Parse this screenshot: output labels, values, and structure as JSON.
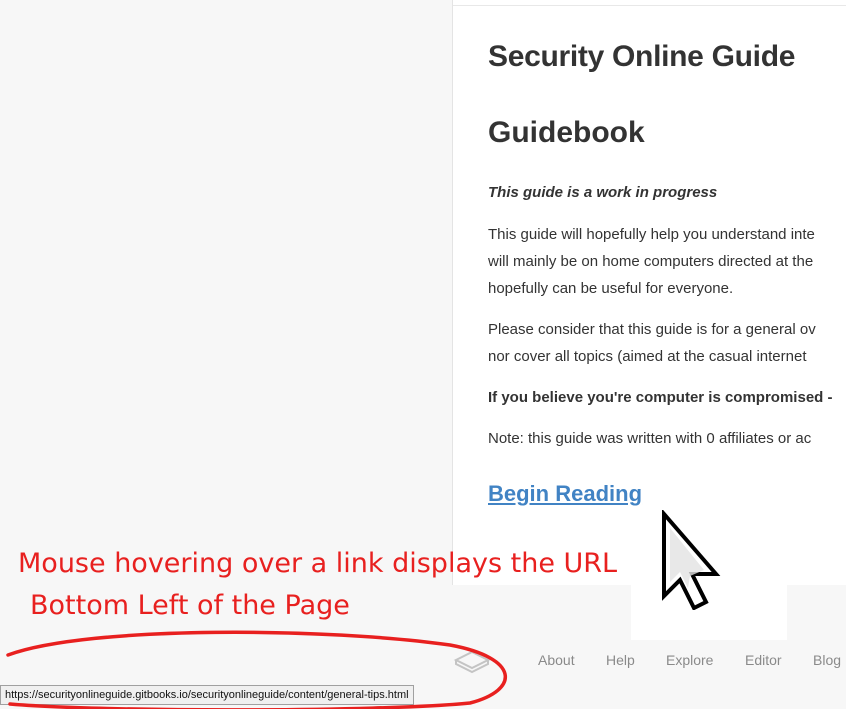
{
  "page": {
    "title": "Security Online Guide",
    "heading": "Guidebook",
    "notice": "This guide is a work in progress",
    "paragraph1_lines": [
      "This guide will hopefully help you understand inte",
      "will mainly be on home computers directed at the",
      "hopefully can be useful for everyone."
    ],
    "paragraph2_lines": [
      "Please consider that this guide is for a general ov",
      "nor cover all topics (aimed at the casual internet"
    ],
    "bold_line": "If you believe you're computer is compromised -",
    "note_line": "Note: this guide was written with 0 affiliates or ac",
    "begin_link": "Begin Reading"
  },
  "footer": {
    "links": [
      "About",
      "Help",
      "Explore",
      "Editor",
      "Blog"
    ],
    "logo_icon": "gitbook-logo-icon"
  },
  "status_bar": {
    "url": "https://securityonlineguide.gitbooks.io/securityonlineguide/content/general-tips.html"
  },
  "annotation": {
    "line1": "Mouse hovering over a link displays the URL",
    "line2": "Bottom Left of the Page",
    "color": "#e8201f"
  },
  "colors": {
    "link": "#4183c4",
    "text": "#333333",
    "footer_link": "#8a8a8a",
    "annotation": "#e8201f"
  }
}
